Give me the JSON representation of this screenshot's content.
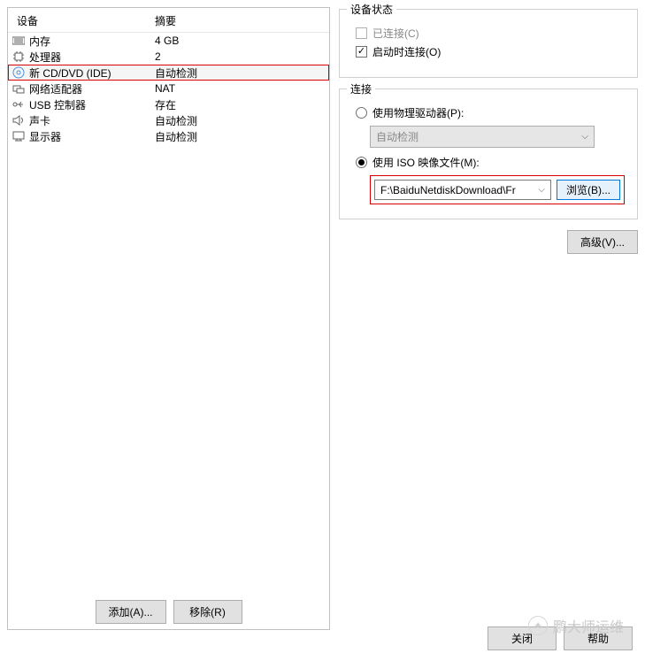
{
  "leftPanel": {
    "headers": {
      "device": "设备",
      "summary": "摘要"
    },
    "rows": [
      {
        "name": "内存",
        "summary": "4 GB"
      },
      {
        "name": "处理器",
        "summary": "2"
      },
      {
        "name": "新 CD/DVD (IDE)",
        "summary": "自动检测",
        "highlighted": true
      },
      {
        "name": "网络适配器",
        "summary": "NAT"
      },
      {
        "name": "USB 控制器",
        "summary": "存在"
      },
      {
        "name": "声卡",
        "summary": "自动检测"
      },
      {
        "name": "显示器",
        "summary": "自动检测"
      }
    ],
    "addBtn": "添加(A)...",
    "removeBtn": "移除(R)"
  },
  "rightPanel": {
    "status": {
      "legend": "设备状态",
      "connected": "已连接(C)",
      "connectAtPower": "启动时连接(O)"
    },
    "connection": {
      "legend": "连接",
      "physical": "使用物理驱动器(P):",
      "autoDetect": "自动检测",
      "iso": "使用 ISO 映像文件(M):",
      "isoPath": "F:\\BaiduNetdiskDownload\\Fr",
      "browse": "浏览(B)..."
    },
    "advanced": "高级(V)..."
  },
  "footer": {
    "close": "关闭",
    "help": "帮助"
  },
  "watermark": "鹏大师运维"
}
